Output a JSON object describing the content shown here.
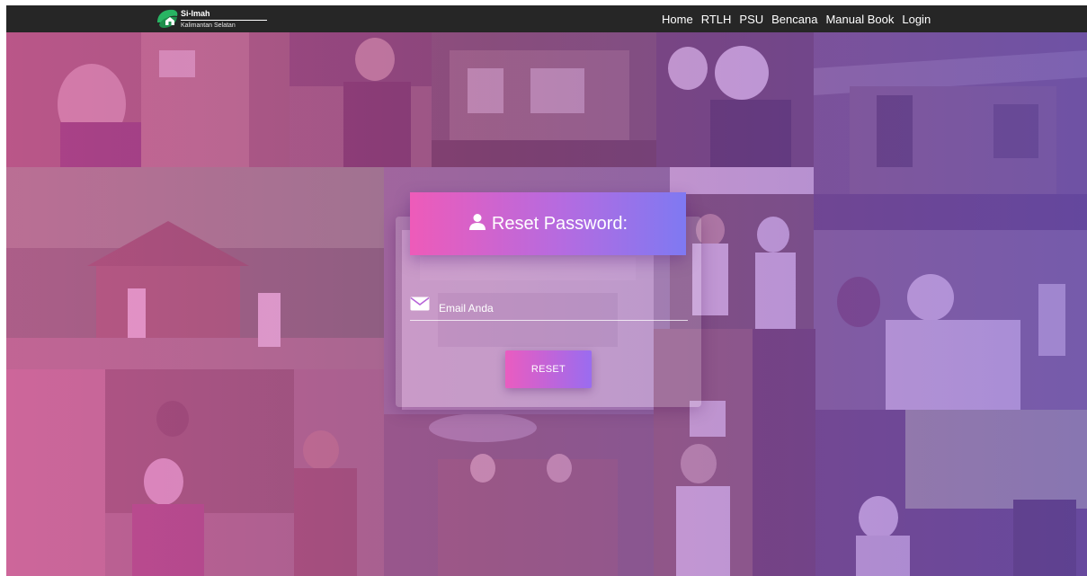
{
  "brand": {
    "name": "Si-Imah",
    "subtitle": "Kalimantan Selatan",
    "logo_icon": "leaf-house-logo"
  },
  "nav": {
    "items": [
      {
        "label": "Home"
      },
      {
        "label": "RTLH"
      },
      {
        "label": "PSU"
      },
      {
        "label": "Bencana"
      },
      {
        "label": "Manual Book"
      },
      {
        "label": "Login"
      }
    ]
  },
  "form": {
    "title": "Reset Password:",
    "title_icon": "user-icon",
    "email_icon": "envelope-icon",
    "email_placeholder": "Email Anda",
    "email_value": "",
    "submit_label": "RESET"
  },
  "colors": {
    "navbar_bg": "#262626",
    "gradient_start": "#ee5bb9",
    "gradient_end": "#7f79f2"
  }
}
